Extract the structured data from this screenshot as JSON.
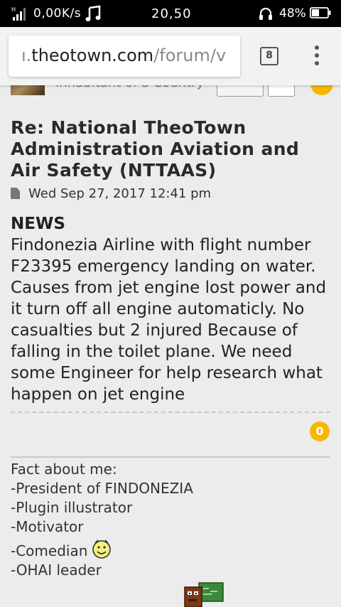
{
  "status_bar": {
    "network": "H",
    "speed": "0,00K/s",
    "time": "20,50",
    "battery_percent": "48%",
    "battery_level": 0.48
  },
  "browser": {
    "url_host": "theotown.com",
    "url_prefix": "ı.",
    "url_path": "/forum/v",
    "tab_count": "8"
  },
  "profile": {
    "rank_text": "Inhabitant of a Country"
  },
  "post": {
    "title": "Re: National TheoTown Administration Aviation and Air Safety (NTTAAS)",
    "date": "Wed Sep 27, 2017 12:41 pm",
    "heading": "NEWS",
    "body": "Findonezia Airline with flight number F23395 emergency landing on water. Causes from jet engine lost power and it turn off all engine automaticly. No casualties but 2 injured Because of falling in the toilet plane. We need some Engineer for help research what happen on jet engine",
    "like_count": "0"
  },
  "signature": {
    "lines": [
      "Fact about me:",
      "-President of FINDONEZIA",
      "-Plugin illustrator",
      "-Motivator",
      "-Comedian",
      "-OHAI leader"
    ]
  },
  "colors": {
    "accent_badge": "#f5b800",
    "background": "#ececec"
  },
  "icons": [
    "signal-icon",
    "music-note-icon",
    "headphones-icon",
    "battery-icon",
    "tabs-icon",
    "overflow-menu-icon",
    "post-icon",
    "smiley-icon"
  ]
}
